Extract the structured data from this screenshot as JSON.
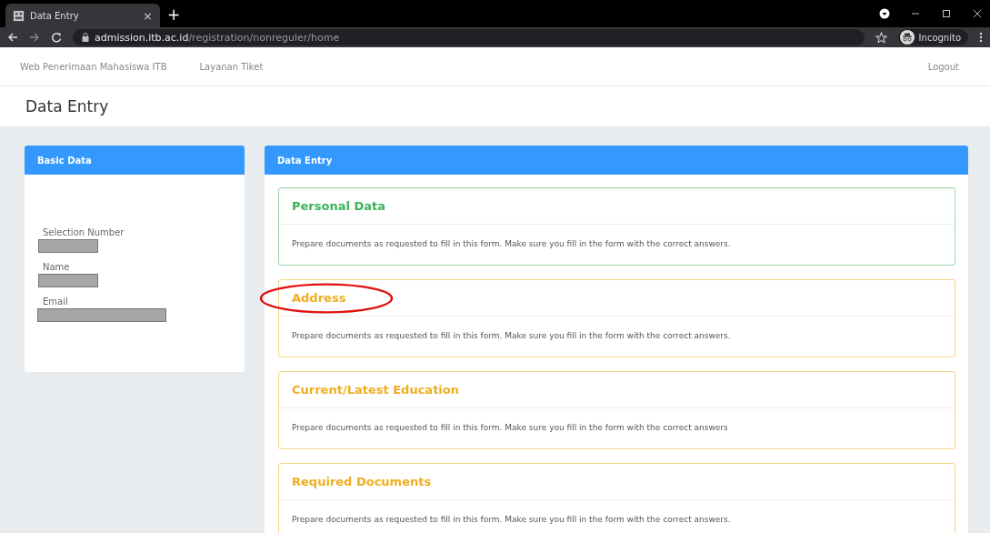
{
  "browser": {
    "tab_title": "Data Entry",
    "tab_close": "×",
    "new_tab": "+",
    "url_host": "admission.itb.ac.id",
    "url_path": "/registration/nonreguler/home",
    "profile": "Incognito"
  },
  "nav": {
    "links": [
      "Web Penerimaan Mahasiswa ITB",
      "Layanan Tiket"
    ],
    "logout": "Logout"
  },
  "page_title": "Data Entry",
  "basic_data": {
    "title": "Basic Data",
    "fields": [
      {
        "label": "Selection Number",
        "redacted": true,
        "kind": "short"
      },
      {
        "label": "Name",
        "redacted": true,
        "kind": "short"
      },
      {
        "label": "Email",
        "redacted": true,
        "kind": "long"
      }
    ]
  },
  "data_entry": {
    "title": "Data Entry",
    "sections": [
      {
        "title": "Personal Data",
        "color": "#3cb25a",
        "text": "Prepare documents as requested to fill in this form. Make sure you fill in the form with the correct answers.",
        "highlighted": false
      },
      {
        "title": "Address",
        "color": "#f0ad1e",
        "text": "Prepare documents as requested to fill in this form. Make sure you fill in the form with the correct answers.",
        "highlighted": true
      },
      {
        "title": "Current/Latest Education",
        "color": "#f0ad1e",
        "text": "Prepare documents as requested to fill in this form. Make sure you fill in the form with the correct answers",
        "highlighted": false
      },
      {
        "title": "Required Documents",
        "color": "#f0ad1e",
        "text": "Prepare documents as requested to fill in this form. Make sure you fill in the form with the correct answers.",
        "highlighted": false
      }
    ]
  }
}
